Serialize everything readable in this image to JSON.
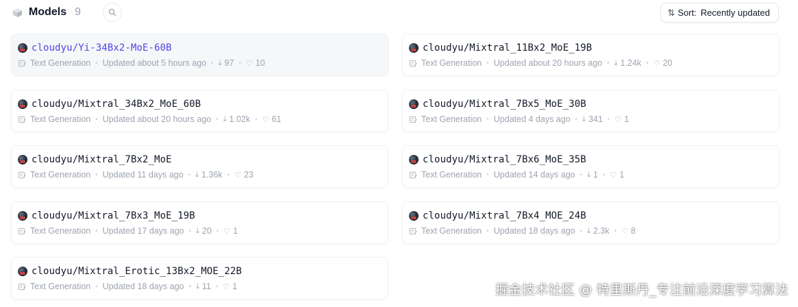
{
  "header": {
    "title": "Models",
    "count": "9",
    "sort_prefix": "Sort:",
    "sort_value": "Recently updated"
  },
  "cards": [
    {
      "name": "cloudyu/Yi-34Bx2-MoE-60B",
      "task": "Text Generation",
      "updated": "Updated about 5 hours ago",
      "downloads": "97",
      "likes": "10"
    },
    {
      "name": "cloudyu/Mixtral_11Bx2_MoE_19B",
      "task": "Text Generation",
      "updated": "Updated about 20 hours ago",
      "downloads": "1.24k",
      "likes": "20"
    },
    {
      "name": "cloudyu/Mixtral_34Bx2_MoE_60B",
      "task": "Text Generation",
      "updated": "Updated about 20 hours ago",
      "downloads": "1.02k",
      "likes": "61"
    },
    {
      "name": "cloudyu/Mixtral_7Bx5_MoE_30B",
      "task": "Text Generation",
      "updated": "Updated 4 days ago",
      "downloads": "341",
      "likes": "1"
    },
    {
      "name": "cloudyu/Mixtral_7Bx2_MoE",
      "task": "Text Generation",
      "updated": "Updated 11 days ago",
      "downloads": "1.36k",
      "likes": "23"
    },
    {
      "name": "cloudyu/Mixtral_7Bx6_MoE_35B",
      "task": "Text Generation",
      "updated": "Updated 14 days ago",
      "downloads": "1",
      "likes": "1"
    },
    {
      "name": "cloudyu/Mixtral_7Bx3_MoE_19B",
      "task": "Text Generation",
      "updated": "Updated 17 days ago",
      "downloads": "20",
      "likes": "1"
    },
    {
      "name": "cloudyu/Mixtral_7Bx4_MOE_24B",
      "task": "Text Generation",
      "updated": "Updated 18 days ago",
      "downloads": "2.3k",
      "likes": "8"
    },
    {
      "name": "cloudyu/Mixtral_Erotic_13Bx2_MOE_22B",
      "task": "Text Generation",
      "updated": "Updated 18 days ago",
      "downloads": "11",
      "likes": "1"
    }
  ],
  "watermark": "掘金技术社区 @ 特里斯丹_专注前沿深度学习算法",
  "colors": {
    "accent": "#4f46e5",
    "muted": "#9ca3af",
    "border": "#e5e7eb"
  }
}
